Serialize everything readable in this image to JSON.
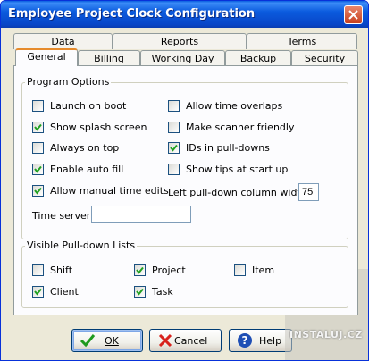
{
  "window": {
    "title": "Employee Project Clock Configuration"
  },
  "tabs": {
    "row_back": [
      "Data",
      "Reports",
      "Terms"
    ],
    "row_front": [
      "General",
      "Billing",
      "Working Day",
      "Backup",
      "Security"
    ],
    "active": "General"
  },
  "program_options": {
    "label": "Program Options",
    "left": [
      {
        "label": "Launch on boot",
        "checked": false
      },
      {
        "label": "Show splash screen",
        "checked": true
      },
      {
        "label": "Always on top",
        "checked": false
      },
      {
        "label": "Enable auto fill",
        "checked": true
      },
      {
        "label": "Allow manual time edits",
        "checked": true
      }
    ],
    "right": [
      {
        "label": "Allow time overlaps",
        "checked": false
      },
      {
        "label": "Make scanner friendly",
        "checked": false
      },
      {
        "label": "IDs in pull-downs",
        "checked": true
      },
      {
        "label": "Show tips at start up",
        "checked": false
      }
    ],
    "column_width_label": "Left pull-down column width:",
    "column_width_value": "75",
    "time_server_label": "Time server:",
    "time_server_value": ""
  },
  "pulldown_lists": {
    "label": "Visible Pull-down Lists",
    "items": [
      {
        "label": "Shift",
        "checked": false
      },
      {
        "label": "Project",
        "checked": true
      },
      {
        "label": "Item",
        "checked": false
      },
      {
        "label": "Client",
        "checked": true
      },
      {
        "label": "Task",
        "checked": true
      }
    ]
  },
  "buttons": {
    "ok": "OK",
    "cancel": "Cancel",
    "help": "Help"
  },
  "watermark": {
    "text": "INSTALUJ.CZ"
  }
}
